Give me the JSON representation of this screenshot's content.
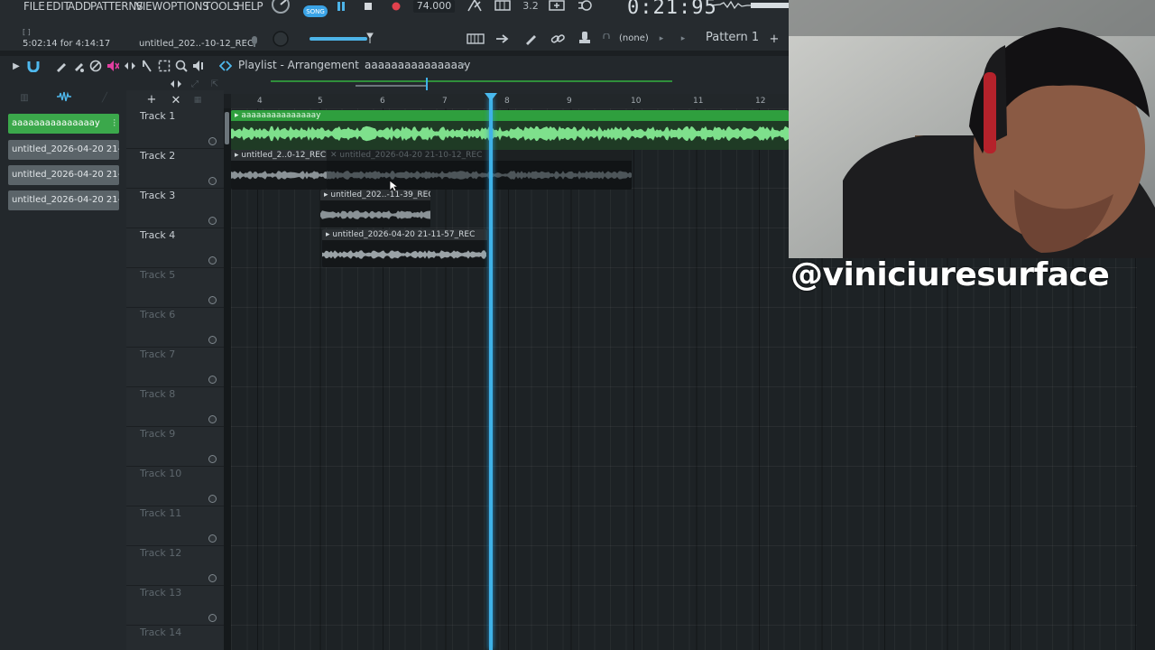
{
  "menu": [
    "FILE",
    "EDIT",
    "ADD",
    "PATTERNS",
    "VIEW",
    "OPTIONS",
    "TOOLS",
    "HELP"
  ],
  "transport": {
    "song_label": "SONG",
    "tempo": "74.000",
    "time": "0:21:95",
    "cpu": "3.2"
  },
  "status": {
    "line": "5:02:14 for 4:14:17",
    "hint": "untitled_202..-10-12_REC"
  },
  "toolbar": {
    "channel": "(none)",
    "pattern": "Pattern 1",
    "plus": "+"
  },
  "breadcrumb": {
    "title": "Playlist - Arrangement",
    "arrangement": "aaaaaaaaaaaaaaay"
  },
  "browser": {
    "items": [
      {
        "label": "aaaaaaaaaaaaaaay",
        "active": true
      },
      {
        "label": "untitled_2026-04-20 21-..",
        "active": false
      },
      {
        "label": "untitled_2026-04-20 21-..",
        "active": false
      },
      {
        "label": "untitled_2026-04-20 21-..",
        "active": false
      }
    ]
  },
  "ruler": [
    "4",
    "5",
    "6",
    "7",
    "8",
    "9",
    "10",
    "11",
    "12"
  ],
  "tracks": [
    "Track 1",
    "Track 2",
    "Track 3",
    "Track 4",
    "Track 5",
    "Track 6",
    "Track 7",
    "Track 8",
    "Track 9",
    "Track 10",
    "Track 11",
    "Track 12",
    "Track 13",
    "Track 14"
  ],
  "clips": {
    "c1": "aaaaaaaaaaaaaaay",
    "c2a": "untitled_2..0-12_REC",
    "c2b": "untitled_2026-04-20 21-10-12_REC",
    "c3": "untitled_202..-11-39_REC",
    "c4": "untitled_2026-04-20 21-11-57_REC"
  },
  "overlay": {
    "handle": "@viniciuresurface"
  },
  "colors": {
    "accent": "#3fb2e8",
    "clip_green": "#2f9f3e",
    "wave_green": "#7ee08c",
    "clip_gray": "#2c3033"
  }
}
